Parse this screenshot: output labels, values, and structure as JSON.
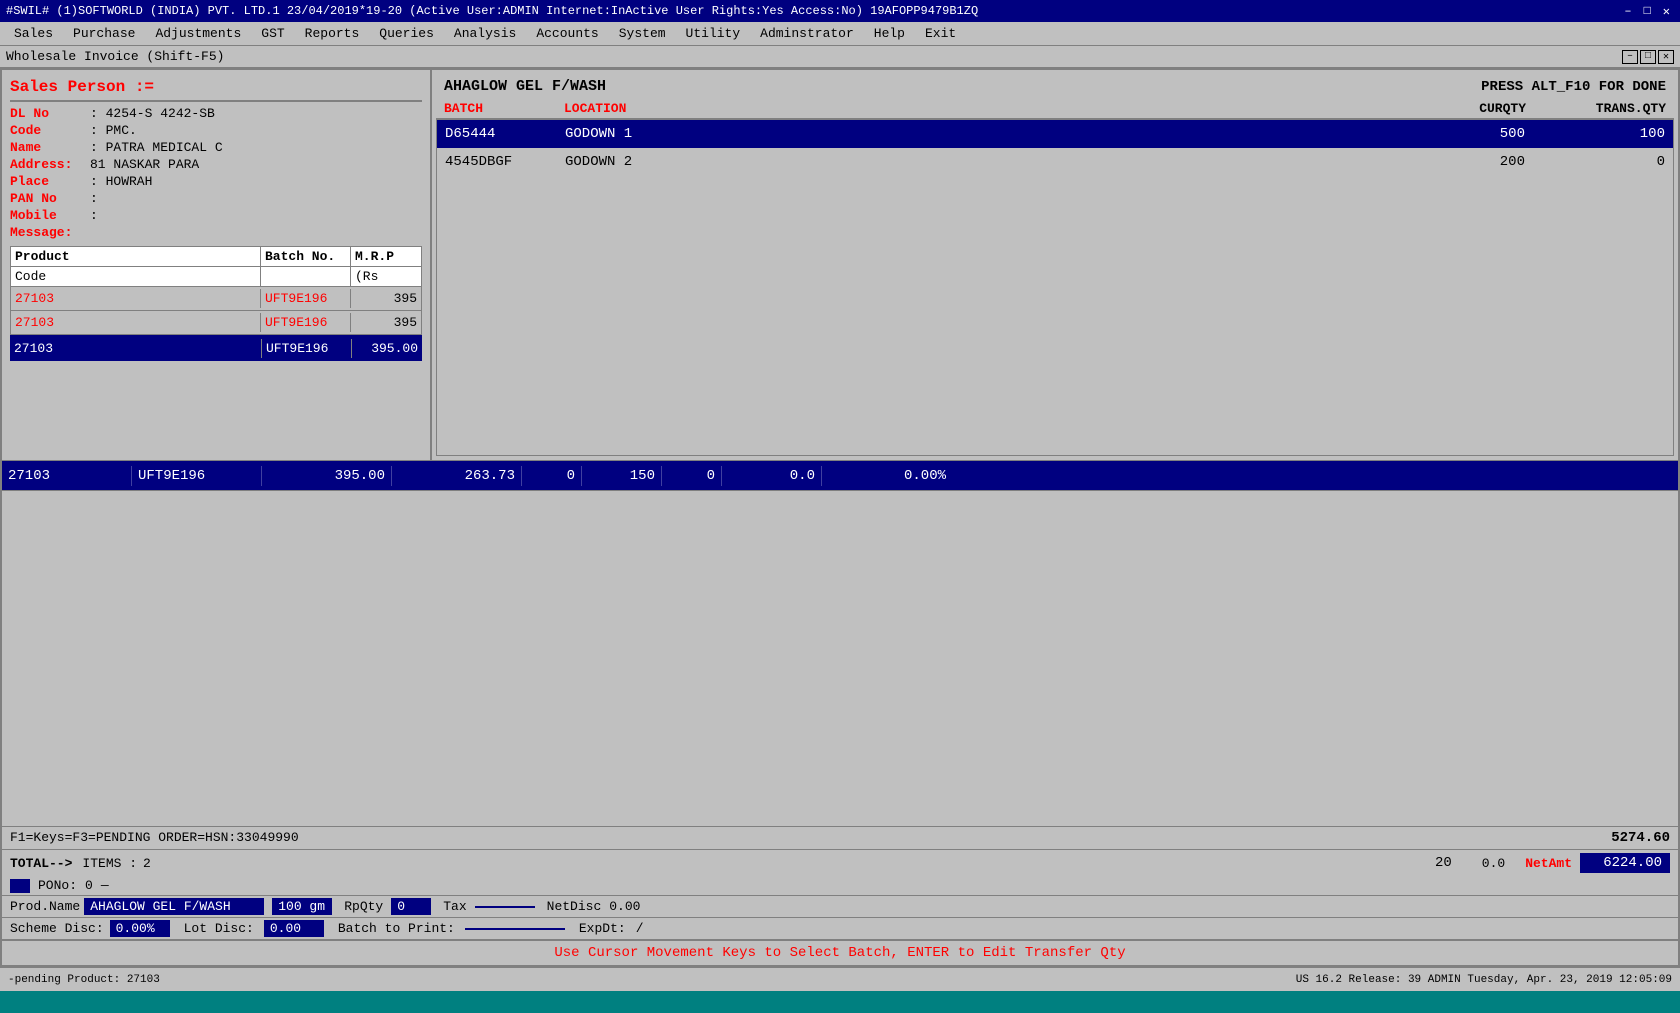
{
  "title_bar": {
    "left_text": "#SWIL#    (1)SOFTWORLD (INDIA) PVT. LTD.1    23/04/2019*19-20    (Active User:ADMIN Internet:InActive User Rights:Yes Access:No) 19AFOPP9479B1ZQ",
    "btn_minimize": "–",
    "btn_maximize": "□",
    "btn_close": "✕"
  },
  "menu": {
    "items": [
      "Sales",
      "Purchase",
      "Adjustments",
      "GST",
      "Reports",
      "Queries",
      "Analysis",
      "Accounts",
      "System",
      "Utility",
      "Adminstrator",
      "Help",
      "Exit"
    ]
  },
  "window": {
    "title": "Wholesale Invoice (Shift-F5)",
    "ctrl_min": "–",
    "ctrl_max": "□",
    "ctrl_close": "✕"
  },
  "left_panel": {
    "sales_person_label": "Sales Person :=",
    "dl_label": "DL No",
    "dl_value": ": 4254-S 4242-SB",
    "code_label": "Code",
    "code_value": ": PMC.",
    "name_label": "Name",
    "name_value": ": PATRA MEDICAL C",
    "address_label": "Address:",
    "address_value": "81 NASKAR PARA",
    "place_label": "Place",
    "place_value": ": HOWRAH",
    "pan_label": "PAN No",
    "pan_value": ":",
    "mobile_label": "Mobile",
    "mobile_value": ":",
    "message_label": "Message:"
  },
  "product_table": {
    "col_product": "Product",
    "col_batch": "Batch No.",
    "col_mrp": "M.R.P",
    "col_code": "Code",
    "col_mrp_rs": "(Rs",
    "rows": [
      {
        "code": "27103",
        "batch": "UFT9E196",
        "mrp": "395"
      },
      {
        "code": "27103",
        "batch": "UFT9E196",
        "mrp": "395"
      }
    ],
    "active_row": {
      "code": "27103",
      "batch": "UFT9E196",
      "mrp": "395.00",
      "val1": "263.73",
      "val2": "0",
      "val3": "150",
      "val4": "0",
      "val5": "0.0",
      "val6": "0.00%"
    }
  },
  "batch_panel": {
    "product_name": "AHAGLOW GEL  F/WASH",
    "press_alt": "PRESS ALT_F10 FOR DONE",
    "col_batch": "BATCH",
    "col_location": "LOCATION",
    "col_curqty": "CURQTY",
    "col_transqty": "TRANS.QTY",
    "rows": [
      {
        "batch": "D65444",
        "location": "GODOWN 1",
        "curqty": "500",
        "transqty": "100",
        "selected": true
      },
      {
        "batch": "4545DBGF",
        "location": "GODOWN 2",
        "curqty": "200",
        "transqty": "0",
        "selected": false
      }
    ]
  },
  "hsn_bar": {
    "text": "F1=Keys=F3=PENDING ORDER=HSN:33049990",
    "amount": "5274.60"
  },
  "totals_bar": {
    "total_label": "TOTAL-->",
    "items_label": "ITEMS :",
    "items_count": "2",
    "value1": "20",
    "value2": "0.0",
    "net_amt_label": "NetAmt",
    "net_amt_value": "6224.00"
  },
  "po_bar": {
    "po_label": "PONo:",
    "po_value": "0"
  },
  "prod_detail": {
    "prod_name_label": "Prod.Name",
    "prod_name_value": "AHAGLOW GEL F/WASH",
    "qty_value": "100 gm",
    "rpqty_label": "RpQty",
    "rpqty_value": "0",
    "tax_label": "Tax",
    "tax_value": "",
    "netdisc_label": "NetDisc",
    "netdisc_value": "0.00"
  },
  "scheme_bar": {
    "scheme_label": "Scheme Disc:",
    "scheme_value": "0.00%",
    "lot_label": "Lot Disc:",
    "lot_value": "0.00",
    "batch_print_label": "Batch to Print:",
    "batch_print_value": "",
    "expdt_label": "ExpDt:",
    "expdt_value": "/"
  },
  "instruction": "Use Cursor Movement Keys to Select Batch, ENTER to Edit Transfer Qty",
  "status_bar": {
    "left": "-pending Product: 27103",
    "right": "US 16.2 Release: 39  ADMIN  Tuesday, Apr. 23, 2019  12:05:09"
  }
}
